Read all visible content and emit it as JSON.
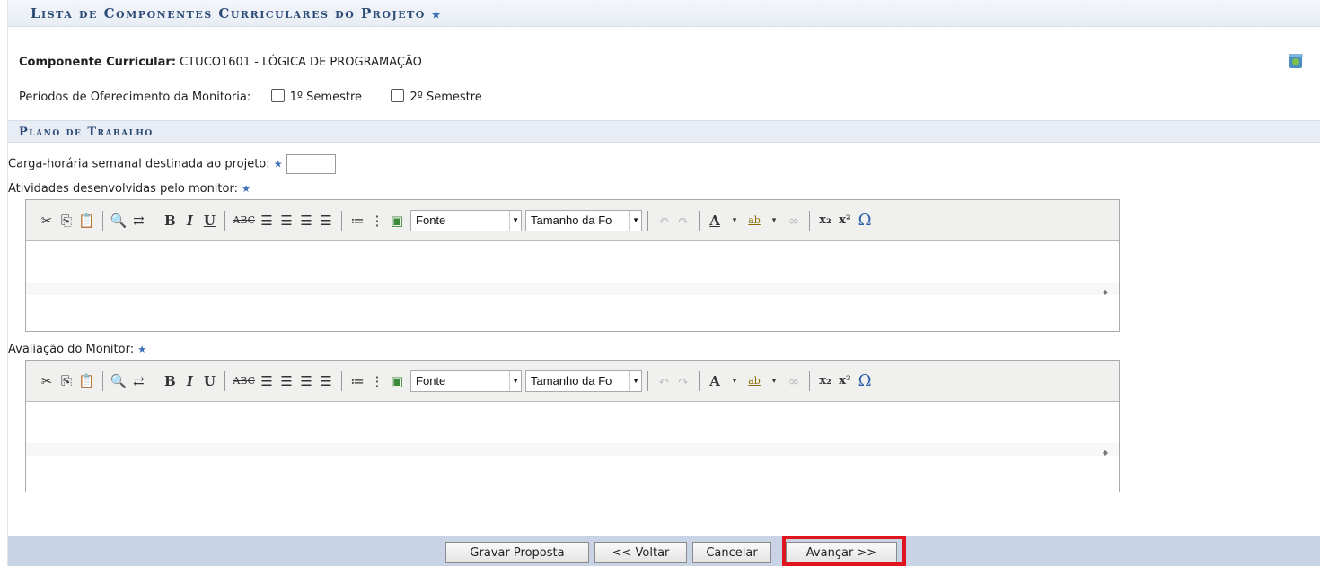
{
  "section": {
    "title": "Lista de Componentes Curriculares do Projeto",
    "star": "★"
  },
  "component": {
    "label": "Componente Curricular:",
    "value": "CTUCO1601 - LÓGICA DE PROGRAMAÇÃO"
  },
  "periods": {
    "label": "Períodos de Oferecimento da Monitoria:",
    "options": [
      "1º Semestre",
      "2º Semestre"
    ]
  },
  "plan": {
    "title": "Plano de Trabalho",
    "hours_label": "Carga-horária semanal destinada ao projeto:",
    "hours_value": "",
    "activities_label": "Atividades desenvolvidas pelo monitor:",
    "evaluation_label": "Avaliação do Monitor:"
  },
  "editor": {
    "font_select": "Fonte",
    "size_select": "Tamanho da Fo"
  },
  "footer": {
    "save": "Gravar Proposta",
    "back": "<< Voltar",
    "cancel": "Cancelar",
    "next": "Avançar >>"
  },
  "colors": {
    "caption_text": "#2b4a75",
    "footer_bg": "#c8d3e6",
    "highlight": "#e0141e"
  }
}
